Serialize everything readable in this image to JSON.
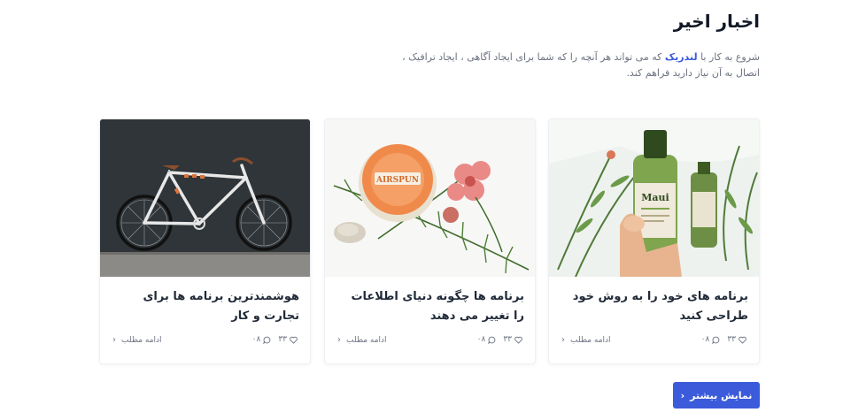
{
  "section": {
    "title": "اخبار اخیر",
    "intro_before": "شروع به کار با ",
    "intro_brand": "لندریک",
    "intro_after": " که می تواند هر آنچه را که شما برای ایجاد آگاهی ، ایجاد ترافیک ، اتصال به آن نیاز دارید فراهم کند."
  },
  "cards": [
    {
      "title": "برنامه های خود را به روش خود طراحی کنید",
      "likes": "۳۳",
      "comments": "۰۸",
      "read_more": "ادامه مطلب",
      "image": "shampoo-bottles-photo"
    },
    {
      "title": "برنامه ها چگونه دنیای اطلاعات را تغییر می دهند",
      "likes": "۳۳",
      "comments": "۰۸",
      "read_more": "ادامه مطلب",
      "image": "cosmetics-flatlay-photo"
    },
    {
      "title": "هوشمندترین برنامه ها برای تجارت و کار",
      "likes": "۳۳",
      "comments": "۰۸",
      "read_more": "ادامه مطلب",
      "image": "bicycle-photo"
    }
  ],
  "show_more": {
    "label": "نمایش بیشتر"
  },
  "colors": {
    "accent": "#3b5bdb",
    "text": "#1f2937",
    "muted": "#6b7280"
  }
}
